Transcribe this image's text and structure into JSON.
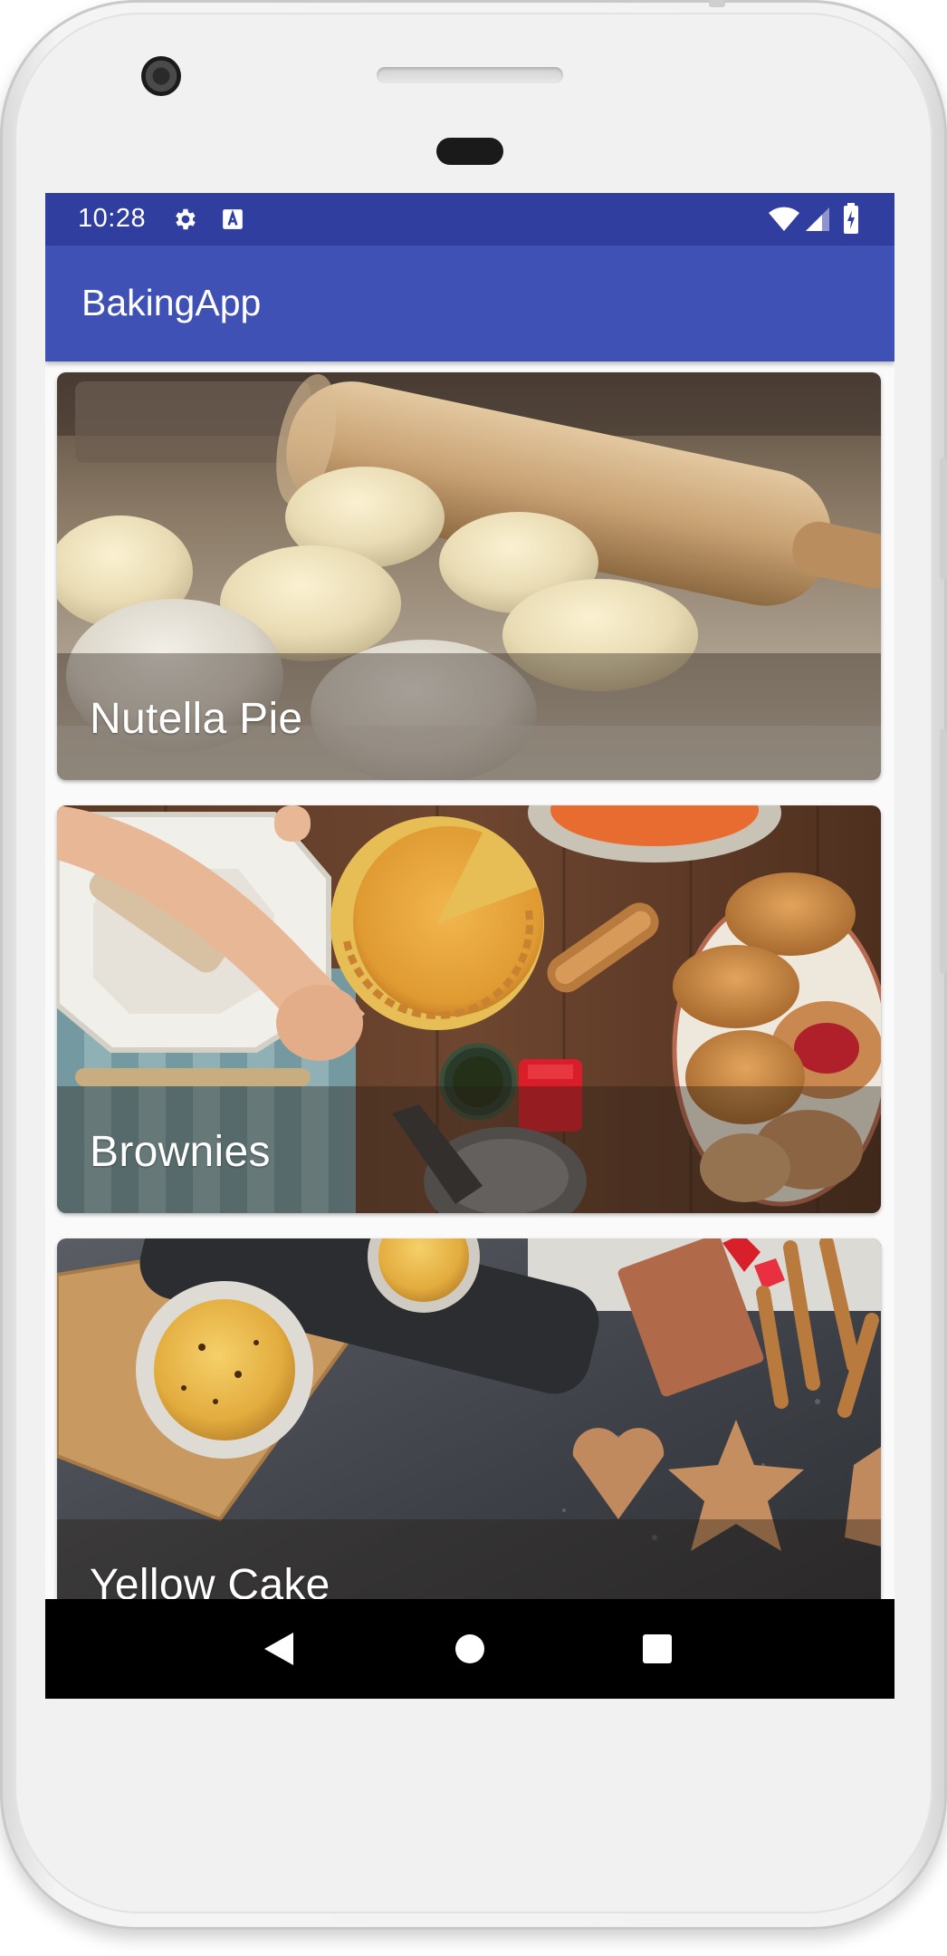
{
  "status_bar": {
    "time": "10:28",
    "left_icons": [
      "gear-icon",
      "a-notification-icon"
    ],
    "right_icons": [
      "wifi-icon",
      "cell-signal-icon",
      "battery-icon"
    ],
    "color": "#303f9f"
  },
  "app_bar": {
    "title": "BakingApp",
    "color": "#3f51b5"
  },
  "recipes": [
    {
      "name": "Nutella Pie"
    },
    {
      "name": "Brownies"
    },
    {
      "name": "Yellow Cake"
    }
  ],
  "nav_bar": {
    "buttons": [
      "back-icon",
      "home-icon",
      "recents-icon"
    ]
  }
}
